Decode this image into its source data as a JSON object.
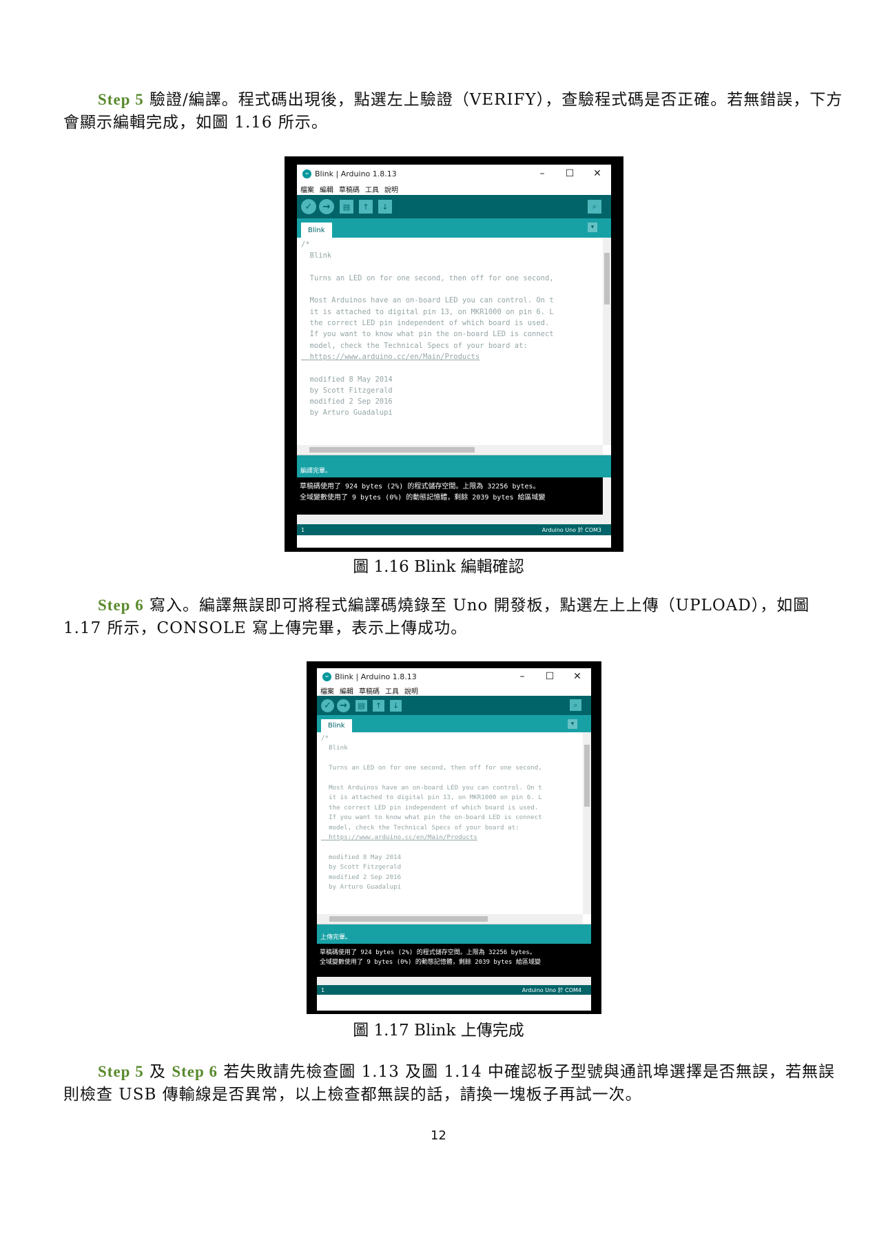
{
  "para1": {
    "step": "Step 5",
    "text": " 驗證/編譯。程式碼出現後，點選左上驗證（VERIFY），查驗程式碼是否正確。若無錯誤，下方會顯示編輯完成，如圖 1.16 所示。"
  },
  "fig1": {
    "caption": "圖 1.16 Blink  編輯確認",
    "window_title": "Blink | Arduino 1.8.13",
    "status": "編譯完畢。",
    "board": "Arduino Uno 於 COM3"
  },
  "para2": {
    "step": "Step 6",
    "text": " 寫入。編譯無誤即可將程式編譯碼燒錄至 Uno 開發板，點選左上上傳（UPLOAD），如圖 1.17 所示，CONSOLE 寫上傳完畢，表示上傳成功。"
  },
  "fig2": {
    "caption": "圖 1.17 Blink  上傳完成",
    "window_title": "Blink | Arduino 1.8.13",
    "status": "上傳完畢。",
    "board": "Arduino Uno 於 COM4"
  },
  "para3": {
    "step_a": "Step 5",
    "and": " 及 ",
    "step_b": "Step 6",
    "text": " 若失敗請先檢查圖 1.13 及圖 1.14 中確認板子型號與通訊埠選擇是否無誤，若無誤則檢查 USB 傳輸線是否異常，以上檢查都無誤的話，請換一塊板子再試一次。"
  },
  "ide": {
    "menu": [
      "檔案",
      "編輯",
      "草稿碼",
      "工具",
      "說明"
    ],
    "tab": "Blink",
    "line_number": "1",
    "code_lines": [
      "/*",
      "  Blink",
      "",
      "  Turns an LED on for one second, then off for one second,",
      "",
      "  Most Arduinos have an on-board LED you can control. On t",
      "  it is attached to digital pin 13, on MKR1000 on pin 6. L",
      "  the correct LED pin independent of which board is used.",
      "  If you want to know what pin the on-board LED is connect",
      "  model, check the Technical Specs of your board at:",
      "  https://www.arduino.cc/en/Main/Products",
      "",
      "  modified 8 May 2014",
      "  by Scott Fitzgerald",
      "  modified 2 Sep 2016",
      "  by Arturo Guadalupi"
    ],
    "console_line1": "草稿碼使用了 924 bytes (2%) 的程式儲存空間。上限為 32256 bytes。",
    "console_line2": "全域變數使用了 9 bytes (0%) 的動態記憶體，剩餘 2039 bytes 給區域變"
  },
  "page_number": "12"
}
